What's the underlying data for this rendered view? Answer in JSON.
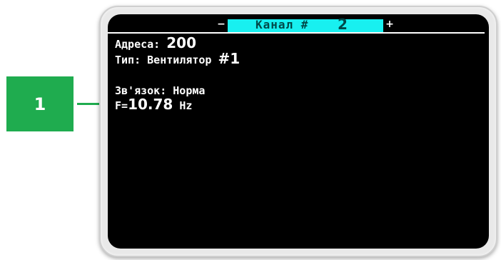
{
  "header": {
    "minus_symbol": "−",
    "plus_symbol": "+",
    "title_label": "Канал #",
    "channel_number": "2"
  },
  "info": {
    "address_label": "Адреса:",
    "address_value": "200",
    "type_label": "Тип:",
    "type_value": "Вентилятор",
    "type_number": "#1",
    "link_label": "Зв'язок:",
    "link_value": "Норма",
    "freq_prefix": "F=",
    "freq_value": "10.78",
    "freq_unit": "Hz"
  },
  "marker": {
    "label": "1"
  },
  "colors": {
    "screen": "#000000",
    "header_band": "#18f0f0",
    "marker": "#1fac4f"
  }
}
